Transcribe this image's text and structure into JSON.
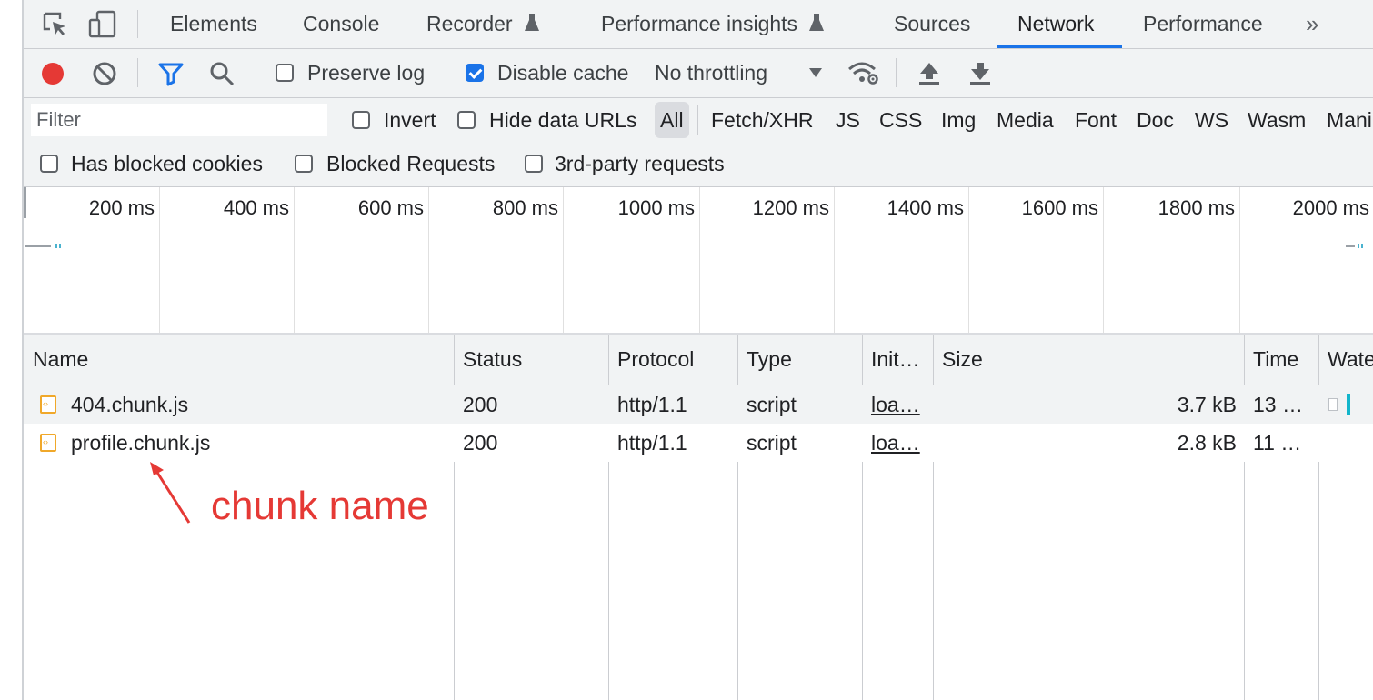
{
  "tabs": [
    {
      "label": "Elements"
    },
    {
      "label": "Console"
    },
    {
      "label": "Recorder"
    },
    {
      "label": "Performance insights"
    },
    {
      "label": "Sources"
    },
    {
      "label": "Network"
    },
    {
      "label": "Performance"
    }
  ],
  "active_tab": "Network",
  "more_tabs_icon": "»",
  "toolbar": {
    "preserve_log_label": "Preserve log",
    "preserve_log_checked": false,
    "disable_cache_label": "Disable cache",
    "disable_cache_checked": true,
    "throttling_value": "No throttling"
  },
  "filter": {
    "placeholder": "Filter",
    "invert_label": "Invert",
    "hide_data_urls_label": "Hide data URLs",
    "types": [
      "All",
      "Fetch/XHR",
      "JS",
      "CSS",
      "Img",
      "Media",
      "Font",
      "Doc",
      "WS",
      "Wasm",
      "Mani"
    ],
    "selected_type": "All",
    "has_blocked_cookies_label": "Has blocked cookies",
    "blocked_requests_label": "Blocked Requests",
    "third_party_label": "3rd-party requests"
  },
  "timeline": {
    "ticks": [
      "200 ms",
      "400 ms",
      "600 ms",
      "800 ms",
      "1000 ms",
      "1200 ms",
      "1400 ms",
      "1600 ms",
      "1800 ms",
      "2000 ms"
    ]
  },
  "table": {
    "columns": [
      "Name",
      "Status",
      "Protocol",
      "Type",
      "Init…",
      "Size",
      "Time",
      "Wate"
    ],
    "rows": [
      {
        "name": "404.chunk.js",
        "status": "200",
        "protocol": "http/1.1",
        "type": "script",
        "initiator": "loa…",
        "size": "3.7 kB",
        "time": "13 …"
      },
      {
        "name": "profile.chunk.js",
        "status": "200",
        "protocol": "http/1.1",
        "type": "script",
        "initiator": "loa…",
        "size": "2.8 kB",
        "time": "11 …"
      }
    ]
  },
  "annotation": {
    "text": "chunk name",
    "color": "#e53935"
  },
  "colors": {
    "accent": "#1a73e8",
    "record": "#e53935",
    "toolbar_bg": "#f1f3f4"
  }
}
